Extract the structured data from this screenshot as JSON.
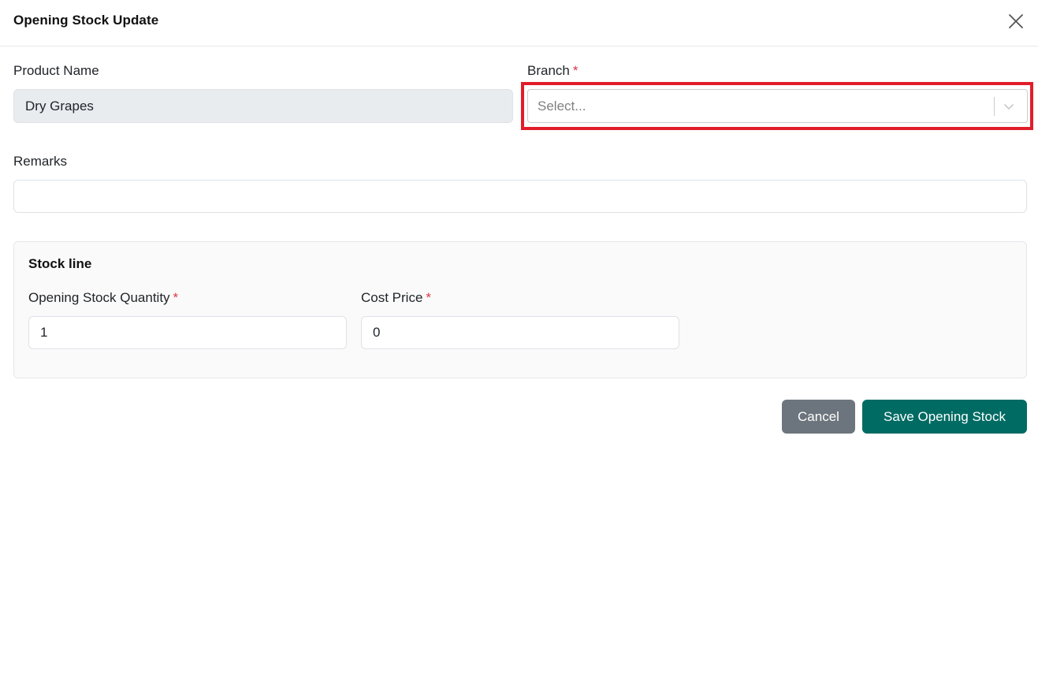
{
  "modal": {
    "title": "Opening Stock Update"
  },
  "product_name": {
    "label": "Product Name",
    "value": "Dry Grapes"
  },
  "branch": {
    "label": "Branch",
    "required_mark": "*",
    "placeholder": "Select..."
  },
  "remarks": {
    "label": "Remarks",
    "value": ""
  },
  "stock_line": {
    "title": "Stock line",
    "quantity": {
      "label": "Opening Stock Quantity",
      "required_mark": "*",
      "value": "1"
    },
    "cost_price": {
      "label": "Cost Price",
      "required_mark": "*",
      "value": "0"
    }
  },
  "actions": {
    "cancel_label": "Cancel",
    "save_label": "Save Opening Stock"
  },
  "colors": {
    "primary": "#006b63",
    "secondary": "#6c757d",
    "required": "#dc3545",
    "highlight": "#e11d2a"
  },
  "icons": {
    "close": "close-icon",
    "dropdown": "chevron-down-icon"
  }
}
